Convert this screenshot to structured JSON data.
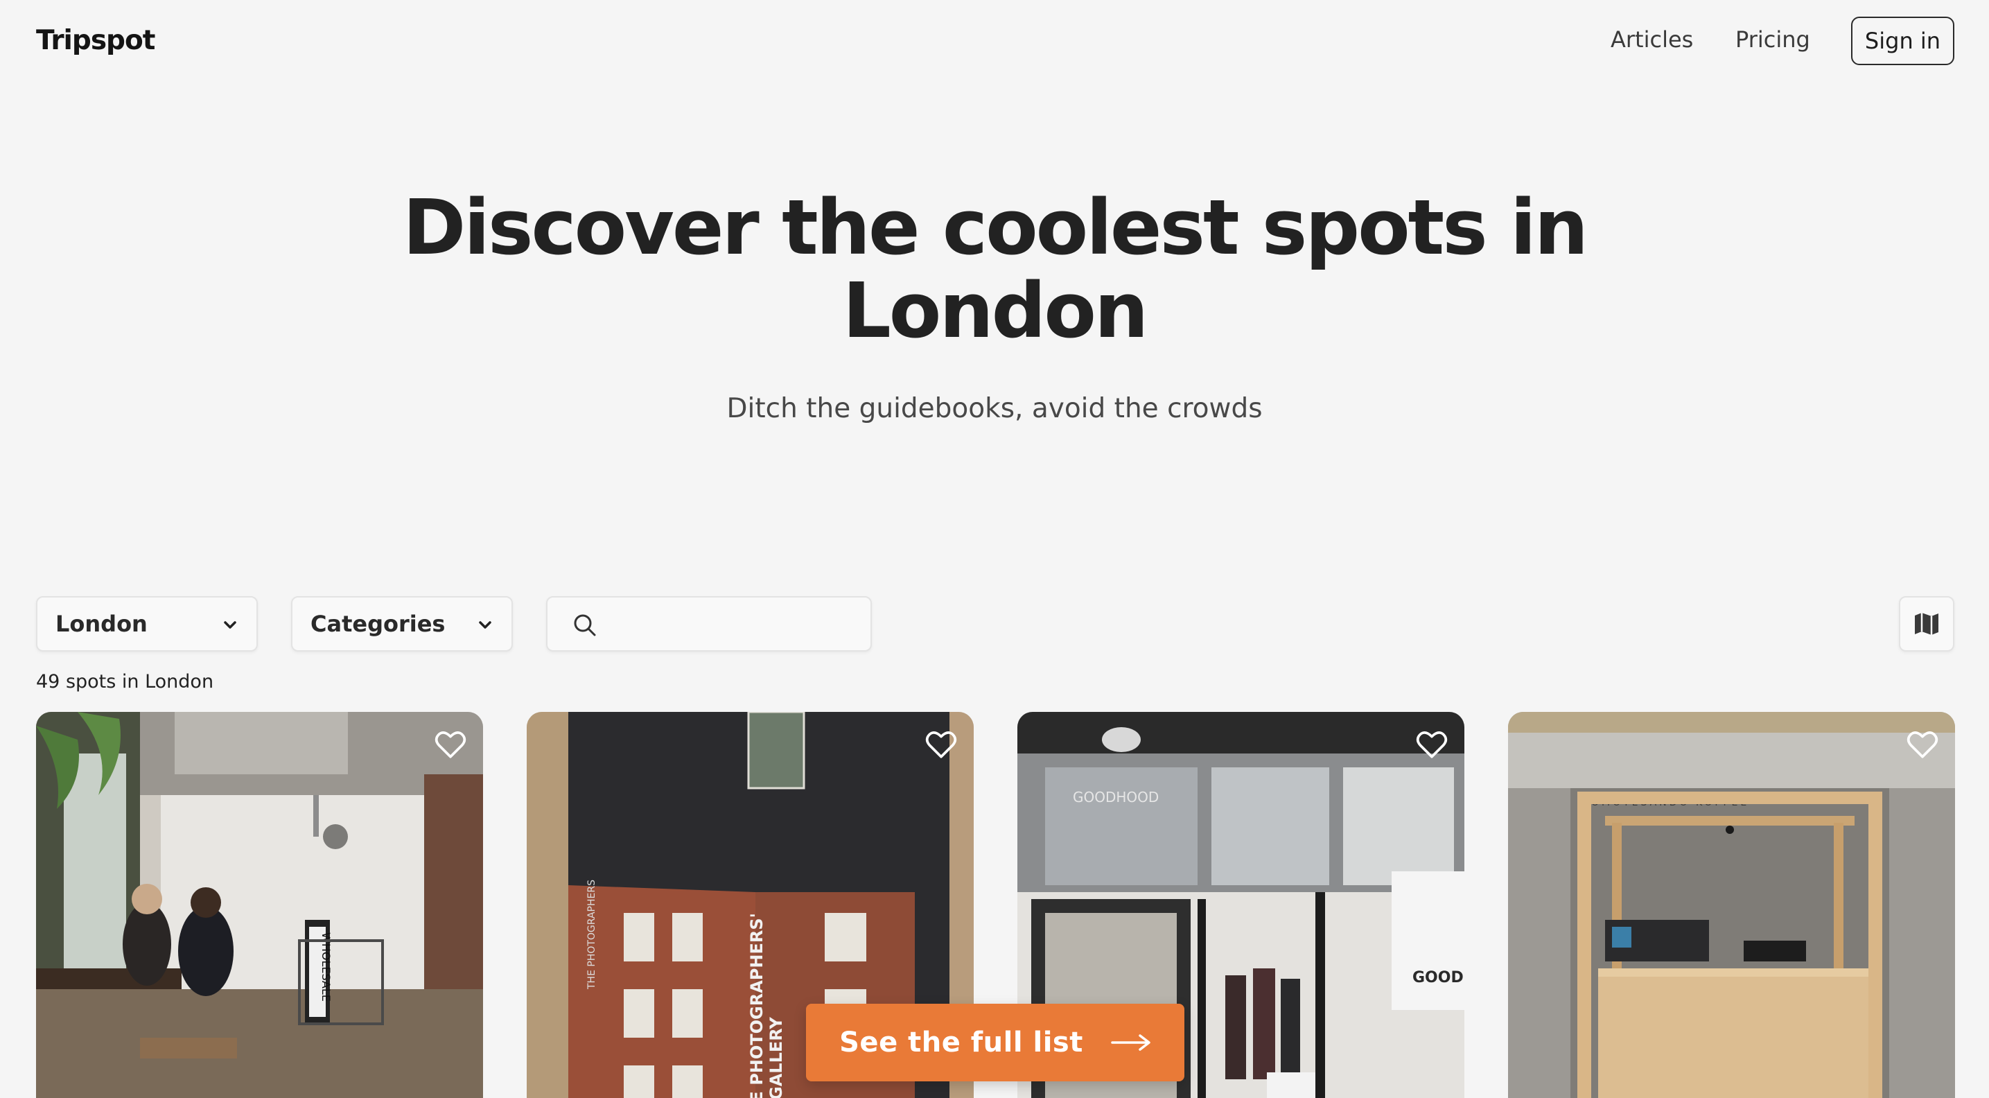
{
  "header": {
    "logo": "Tripspot",
    "nav": {
      "articles": "Articles",
      "pricing": "Pricing"
    },
    "signin": "Sign in"
  },
  "hero": {
    "title_line1": "Discover the coolest spots in",
    "title_line2": "London",
    "subtitle": "Ditch the guidebooks, avoid the crowds"
  },
  "filters": {
    "city": "London",
    "categories": "Categories",
    "search_placeholder": "",
    "search_value": ""
  },
  "results": {
    "count_text": "49 spots in London"
  },
  "cards": [
    {
      "sign_text": "WHOLESALE"
    },
    {
      "sign_text": "THE PHOTOGRAPHERS' GALLERY"
    },
    {
      "sign_text": "GOODHOOD"
    },
    {
      "sign_text": "OMOTESANDO KOFFEE"
    }
  ],
  "cta": {
    "label": "See the full list"
  },
  "colors": {
    "accent": "#e97a37",
    "background": "#f5f5f5"
  },
  "icons": [
    "chevron-down-icon",
    "search-icon",
    "map-icon",
    "heart-icon",
    "arrow-right-icon"
  ]
}
